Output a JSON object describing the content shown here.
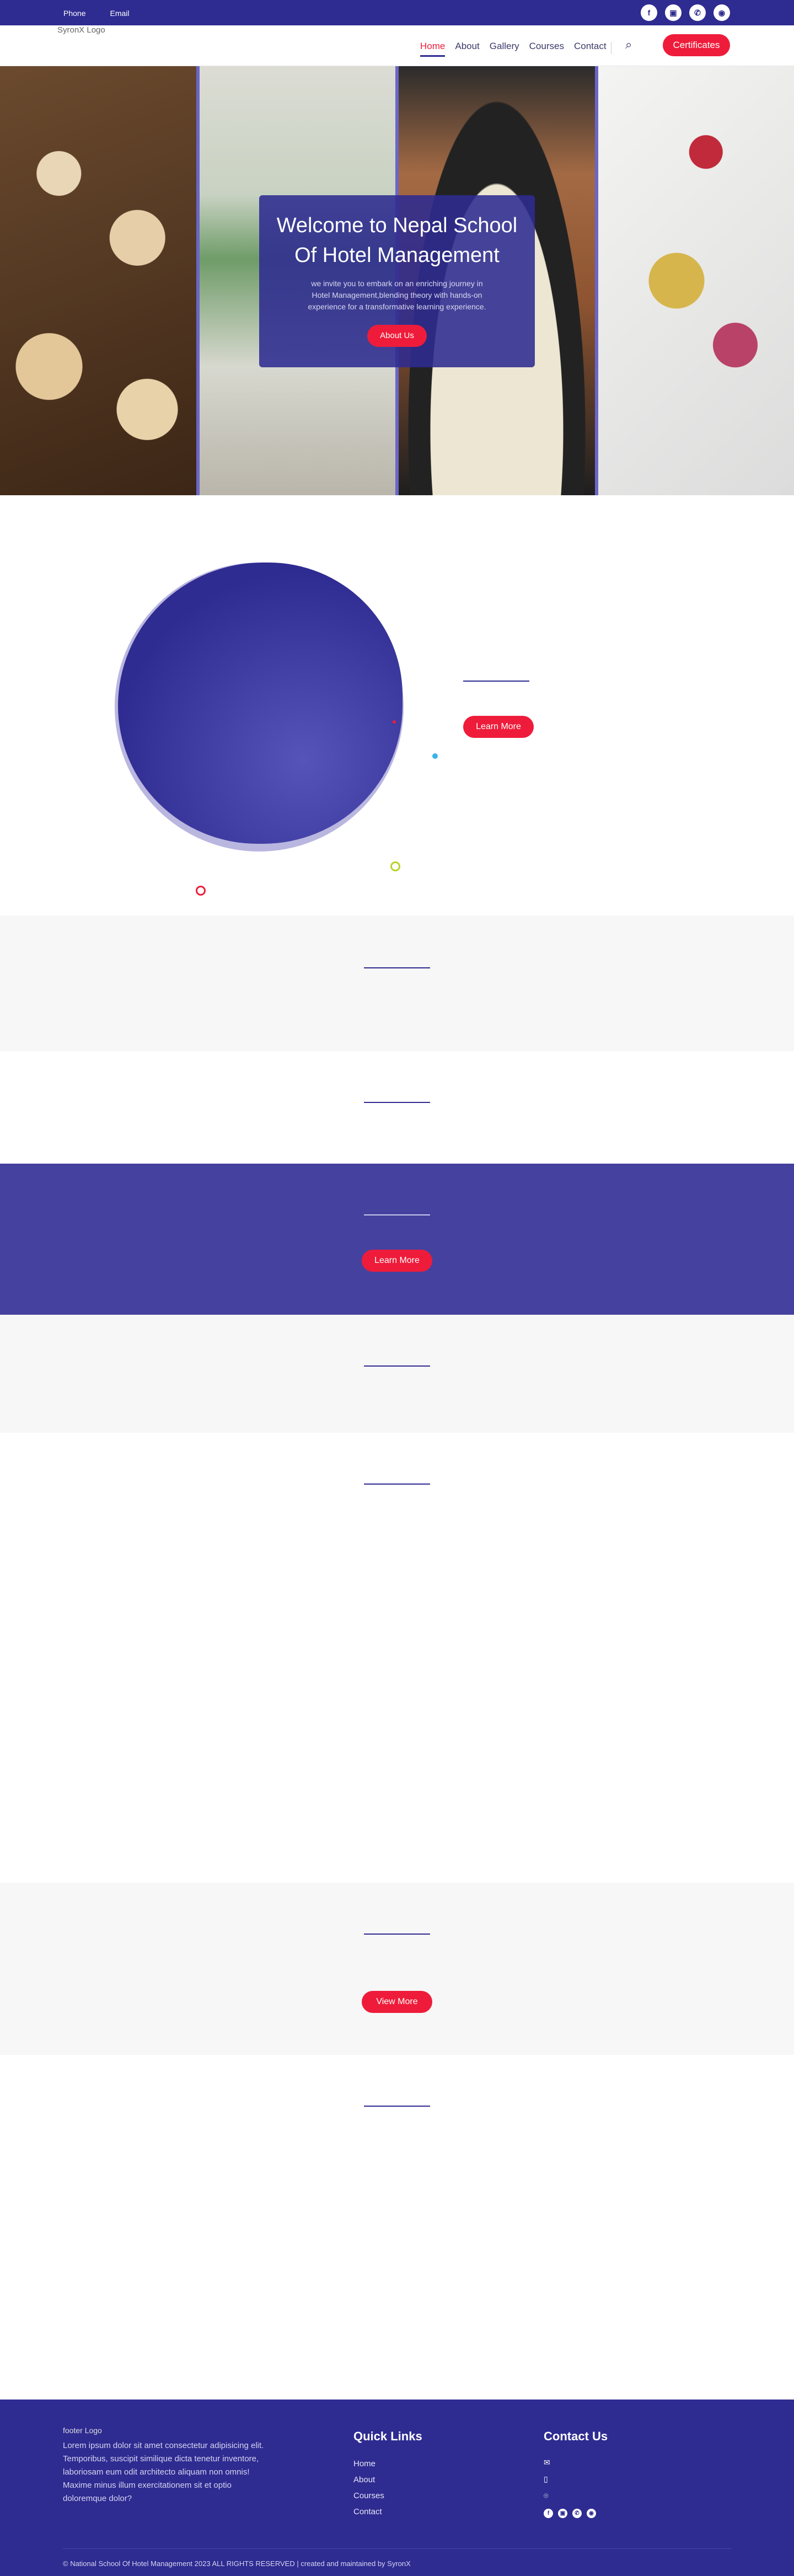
{
  "topbar": {
    "phone_label": "Phone",
    "email_label": "Email",
    "social": [
      "f",
      "▣",
      "✆",
      "◉"
    ],
    "bg": "#2e2b91"
  },
  "nav": {
    "logo_alt": "SyronX Logo",
    "items": [
      "Home",
      "About",
      "Gallery",
      "Courses",
      "Contact"
    ],
    "active": "Home",
    "search_icon": "⌕",
    "cta": "Certificates"
  },
  "hero": {
    "title": "Welcome to Nepal School Of Hotel Management",
    "text": "we invite you to embark on an enriching journey in Hotel Management,blending theory with hands-on experience for a transformative learning experience.",
    "button": "About Us"
  },
  "about": {
    "button": "Learn More"
  },
  "cta_section": {
    "button": "Learn More"
  },
  "gallery": {
    "button": "View More"
  },
  "footer": {
    "logo_alt": "footer Logo",
    "text": "Lorem ipsum dolor sit amet consectetur adipisicing elit. Temporibus, suscipit similique dicta tenetur inventore, laboriosam eum odit architecto aliquam non omnis! Maxime minus illum exercitationem sit et optio doloremque dolor?",
    "quick_links_title": "Quick Links",
    "links": [
      "Home",
      "About",
      "Courses",
      "Contact"
    ],
    "contact_title": "Contact Us",
    "contact_icons": [
      "✉",
      "▯",
      "⌾"
    ],
    "social": [
      "f",
      "▣",
      "✆",
      "◉"
    ],
    "copyright": "© National School Of Hotel Management 2023 ALL RIGHTS RESERVED | created and maintained by SyronX"
  },
  "colors": {
    "primary": "#2e2b91",
    "accent": "#ee1c3a",
    "light_section": "#f7f7f7",
    "cta_section": "#45419f"
  }
}
